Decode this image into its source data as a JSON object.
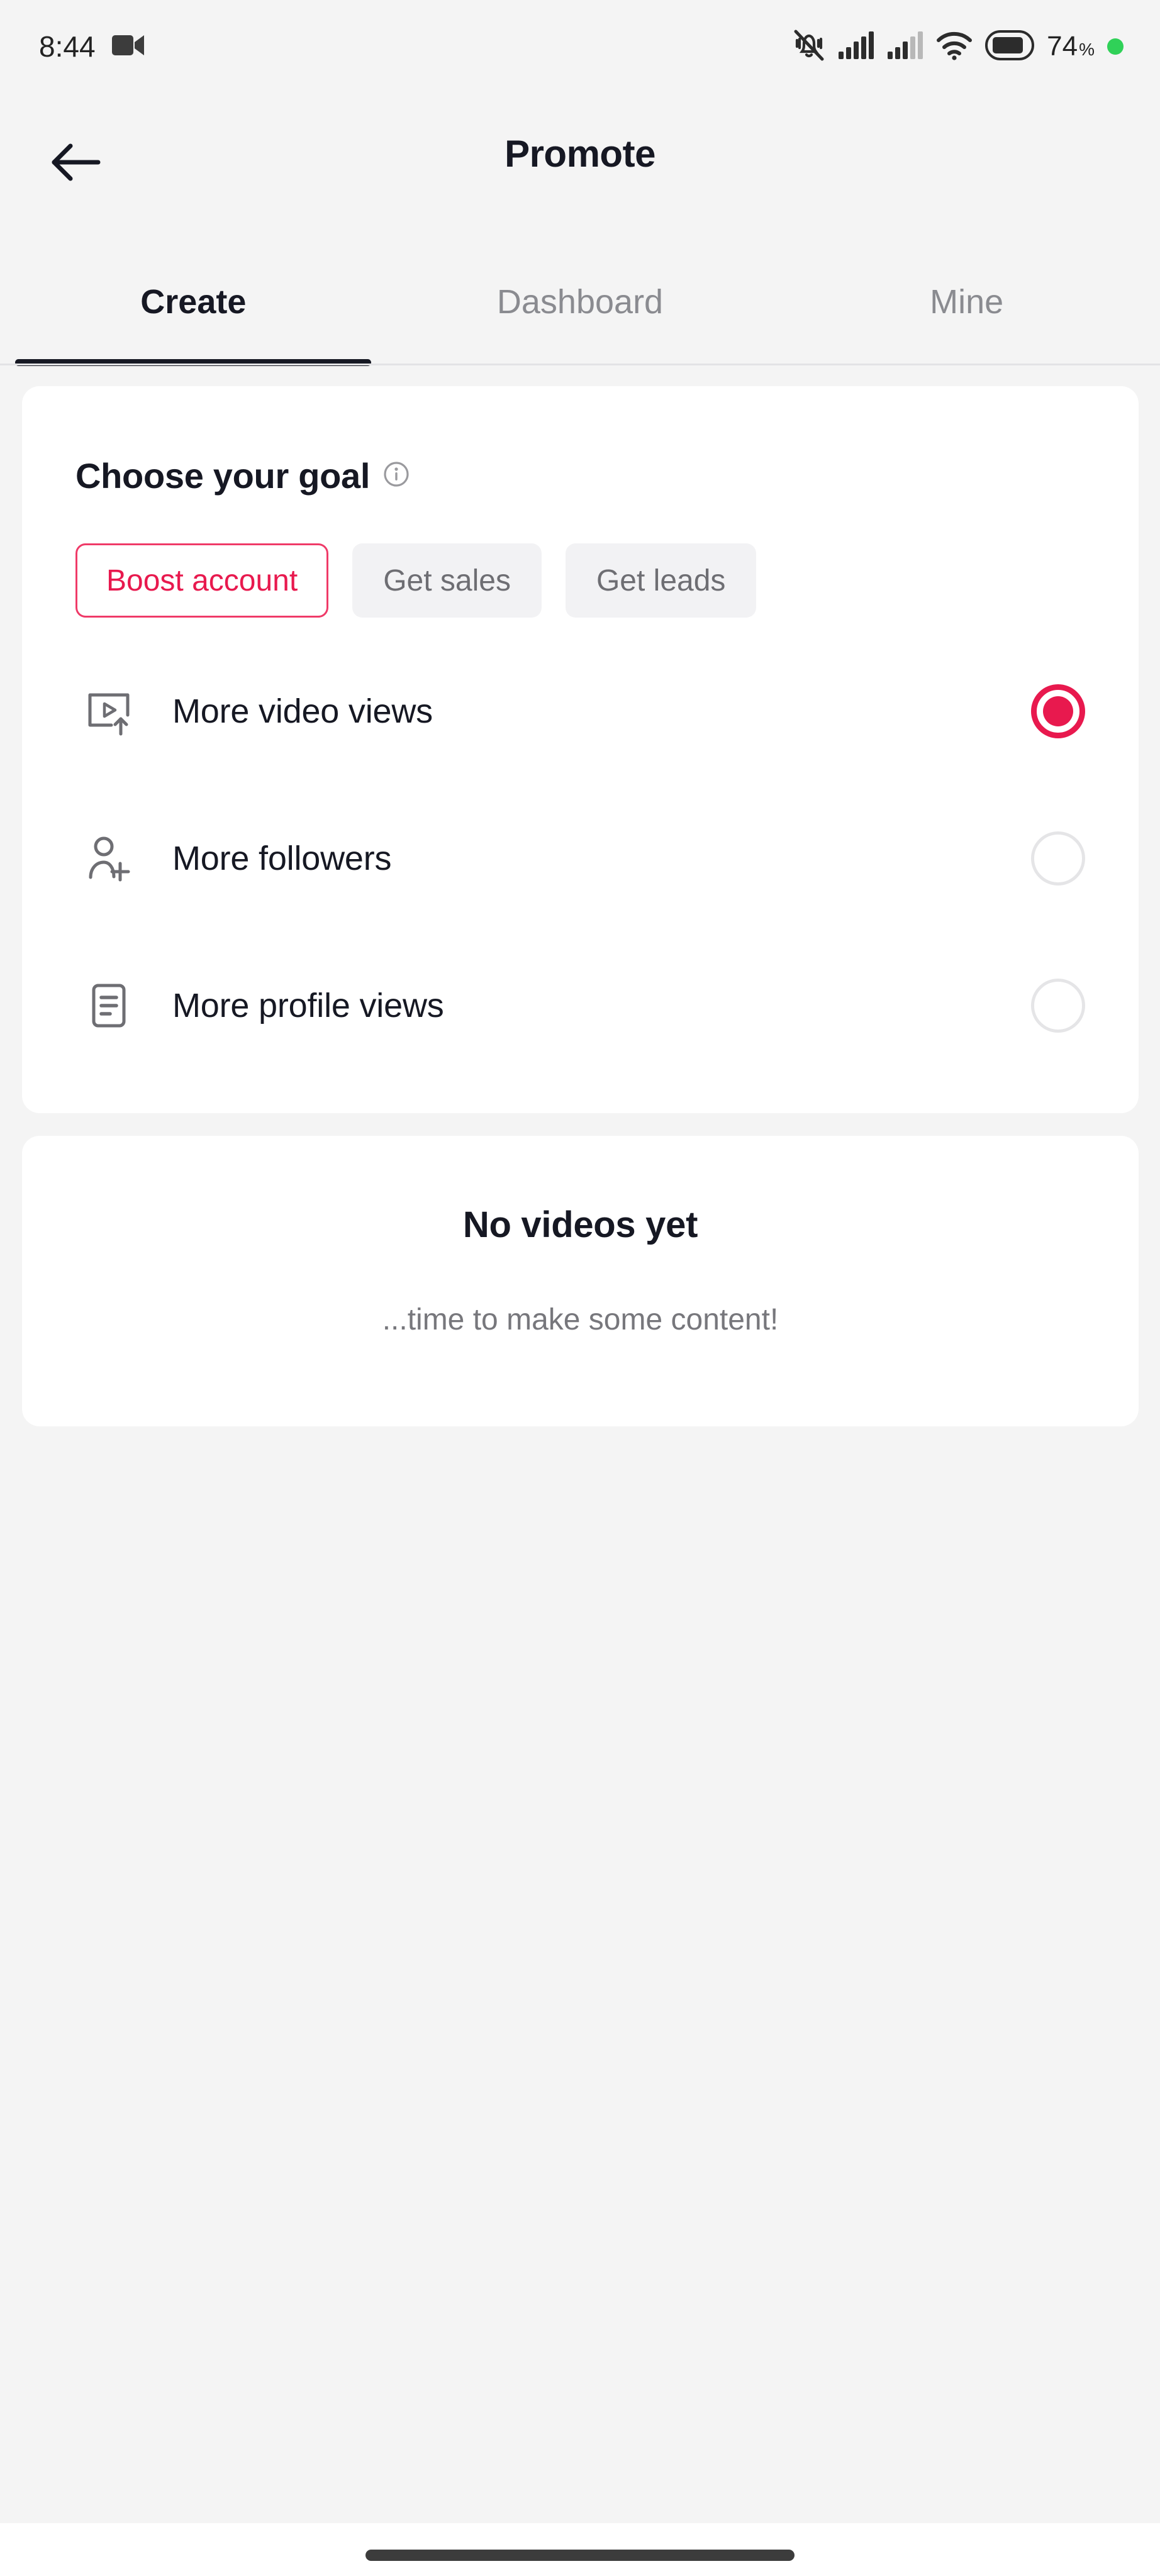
{
  "statusbar": {
    "time": "8:44",
    "video_icon": "video-camera-icon",
    "mute_icon": "bell-muted-icon",
    "signal_icon_1": "cellular-signal-icon",
    "signal_icon_2": "cellular-signal-icon",
    "wifi_icon": "wifi-icon",
    "battery_icon": "battery-icon",
    "battery_level": "74",
    "battery_unit": "%",
    "recording_dot": "green-status-dot"
  },
  "header": {
    "back_icon": "back-arrow-icon",
    "title": "Promote"
  },
  "tabs": {
    "items": [
      {
        "label": "Create",
        "active": true
      },
      {
        "label": "Dashboard",
        "active": false
      },
      {
        "label": "Mine",
        "active": false
      }
    ]
  },
  "goal_card": {
    "title": "Choose your goal",
    "info_icon": "info-circle-icon",
    "chips": [
      {
        "label": "Boost account",
        "selected": true
      },
      {
        "label": "Get sales",
        "selected": false
      },
      {
        "label": "Get leads",
        "selected": false
      }
    ],
    "options": [
      {
        "label": "More video views",
        "icon": "video-upload-icon",
        "selected": true
      },
      {
        "label": "More followers",
        "icon": "person-add-icon",
        "selected": false
      },
      {
        "label": "More profile views",
        "icon": "profile-document-icon",
        "selected": false
      }
    ]
  },
  "empty_state": {
    "title": "No videos yet",
    "subtitle": "...time to make some content!"
  },
  "navigation": {
    "home_indicator": "home-indicator-bar"
  },
  "colors": {
    "accent": "#e8194e",
    "accent_border": "#ef3a68",
    "text_primary": "#161823",
    "text_secondary": "#8a8b90",
    "page_background": "#f4f4f4",
    "card_background": "#ffffff",
    "status_dot": "#30d158"
  }
}
